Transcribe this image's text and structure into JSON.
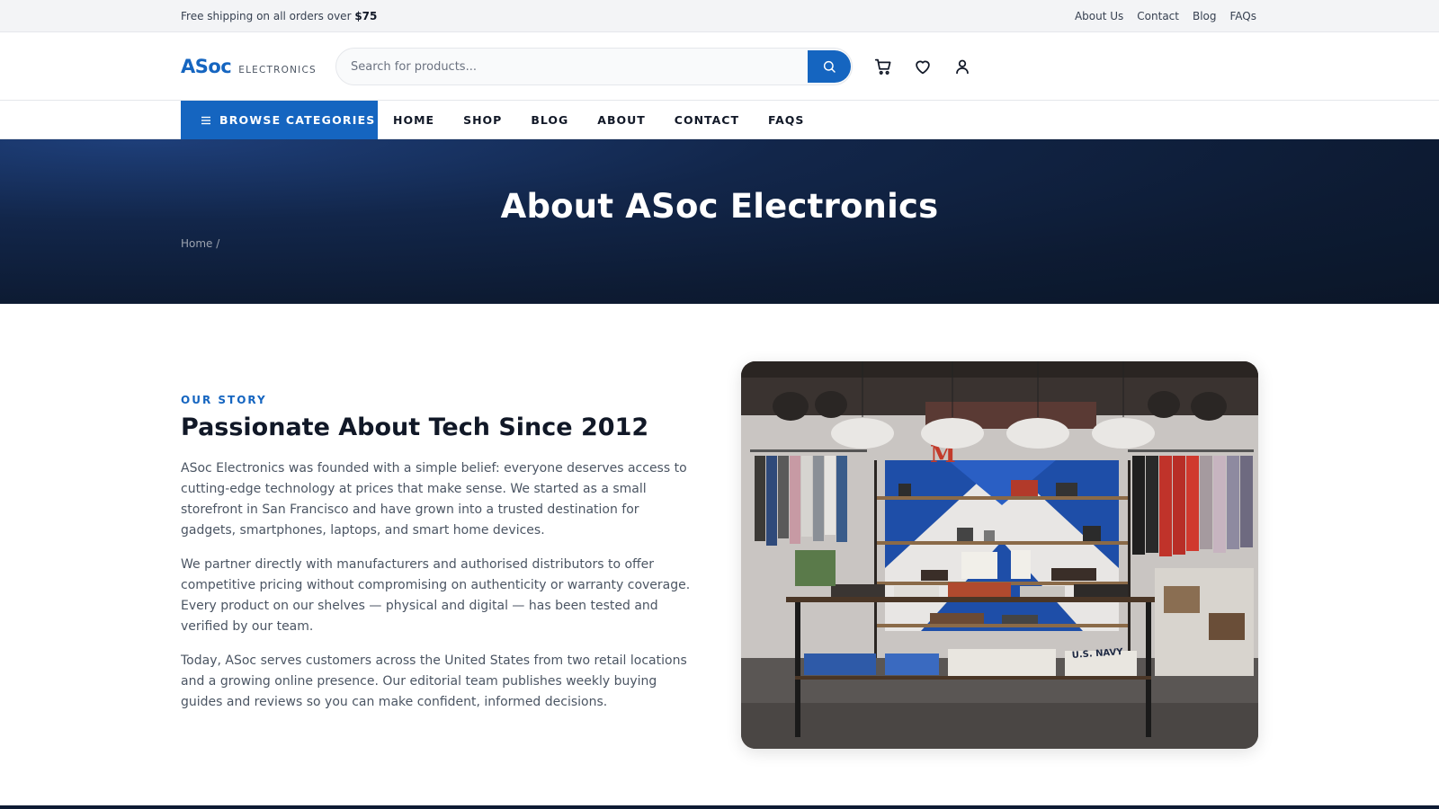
{
  "topbar": {
    "promo_text": "Free shipping on all orders over ",
    "promo_amount": "$75",
    "links": [
      "About Us",
      "Contact",
      "Blog",
      "FAQs"
    ]
  },
  "header": {
    "logo_main": "ASoc",
    "logo_sub": "ELECTRONICS",
    "search_placeholder": "Search for products...",
    "icons": [
      "search-icon",
      "cart-icon",
      "heart-icon",
      "user-icon"
    ]
  },
  "nav": {
    "browse_label": "BROWSE CATEGORIES",
    "items": [
      "HOME",
      "SHOP",
      "BLOG",
      "ABOUT",
      "CONTACT",
      "FAQS"
    ]
  },
  "hero": {
    "title": "About ASoc Electronics",
    "breadcrumb": "Home /"
  },
  "story": {
    "eyebrow": "OUR STORY",
    "heading": "Passionate About Tech Since 2012",
    "paragraphs": [
      "ASoc Electronics was founded with a simple belief: everyone deserves access to cutting-edge technology at prices that make sense. We started as a small storefront in San Francisco and have grown into a trusted destination for gadgets, smartphones, laptops, and smart home devices.",
      "We partner directly with manufacturers and authorised distributors to offer competitive pricing without compromising on authenticity or warranty coverage. Every product on our shelves — physical and digital — has been tested and verified by our team.",
      "Today, ASoc serves customers across the United States from two retail locations and a growing online presence. Our editorial team publishes weekly buying guides and reviews so you can make confident, informed decisions."
    ],
    "image_sign_text": "U.S. NAVY"
  },
  "colors": {
    "accent": "#1565c0",
    "hero_dark": "#0d1b33",
    "text_dark": "#111827",
    "text_body": "#4b5563"
  }
}
